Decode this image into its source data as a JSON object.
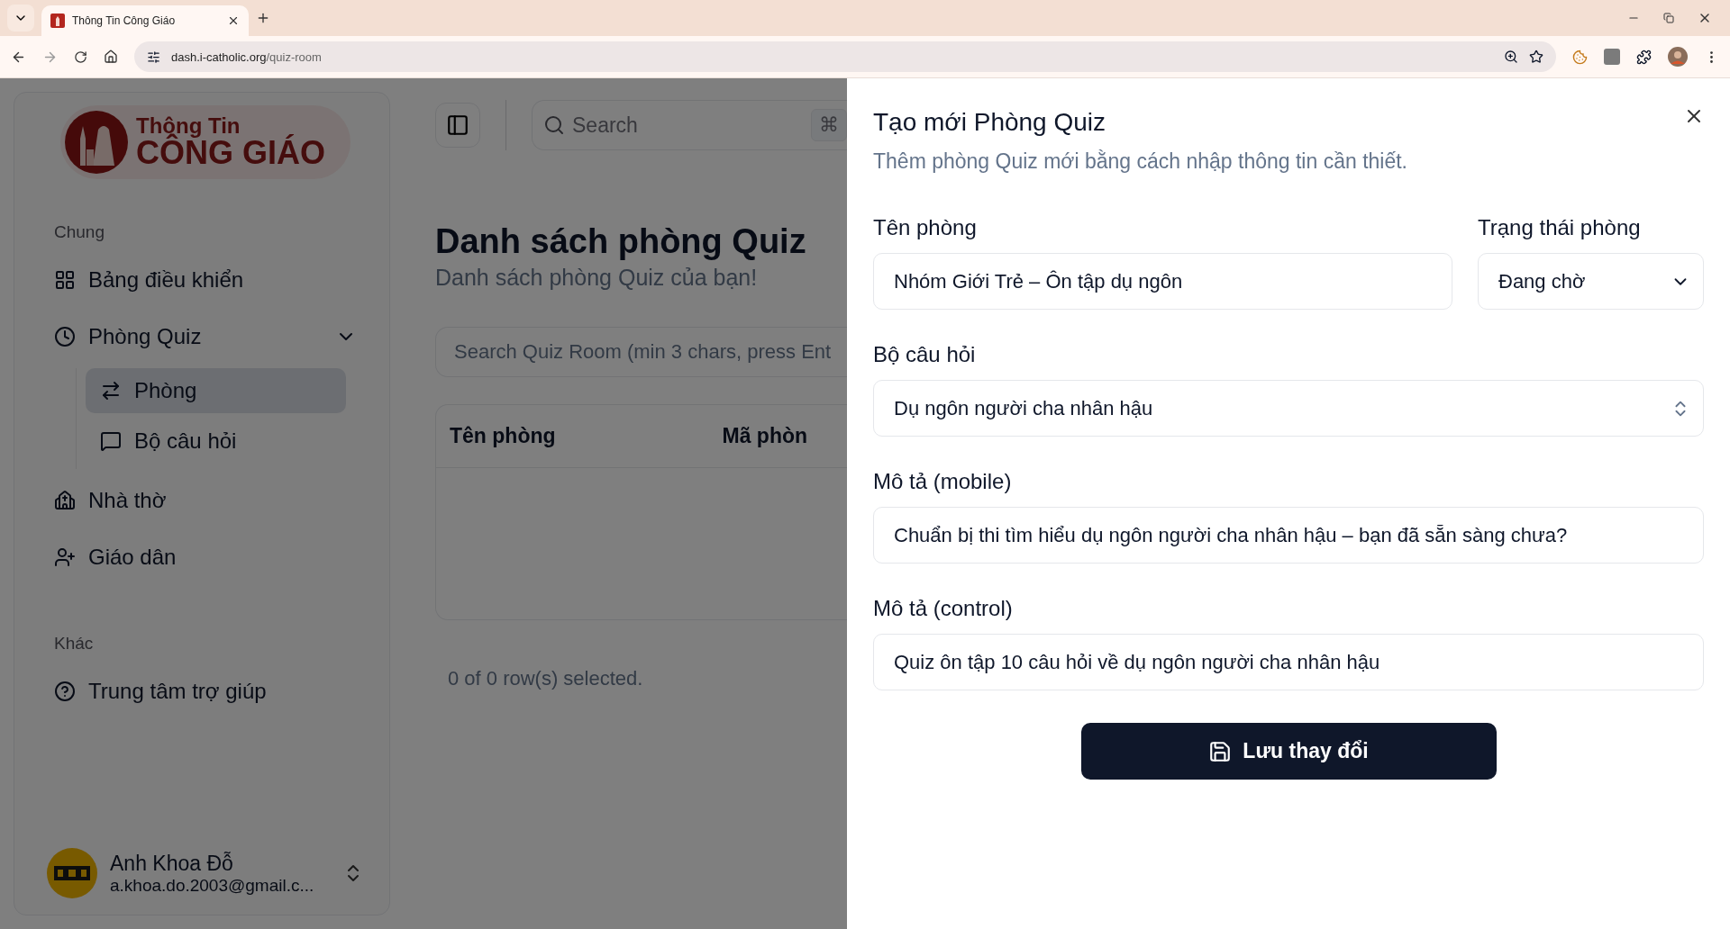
{
  "browser": {
    "tab": {
      "title": "Thông Tin Công Giáo"
    },
    "url": {
      "domain": "dash.i-catholic.org",
      "path": "/quiz-room"
    }
  },
  "sidebar": {
    "logo": {
      "line_1": "Thông Tin",
      "line_2": "CÔNG GIÁO"
    },
    "sections": [
      {
        "heading": "Chung",
        "items": [
          {
            "label": "Bảng điều khiển",
            "selected": false
          },
          {
            "label": "Phòng Quiz",
            "selected": false,
            "expanded": true,
            "children": [
              {
                "label": "Phòng",
                "selected": true
              },
              {
                "label": "Bộ câu hỏi",
                "selected": false
              }
            ]
          },
          {
            "label": "Nhà thờ",
            "selected": false
          },
          {
            "label": "Giáo dân",
            "selected": false
          }
        ]
      },
      {
        "heading": "Khác",
        "items": [
          {
            "label": "Trung tâm trợ giúp",
            "selected": false
          }
        ]
      }
    ],
    "user": {
      "name": "Anh Khoa Đỗ",
      "email": "a.khoa.do.2003@gmail.c..."
    }
  },
  "main": {
    "search": {
      "placeholder": "Search",
      "shortcut": "⌘"
    },
    "title": "Danh sách phòng Quiz",
    "subtitle": "Danh sách phòng Quiz của bạn!",
    "filter": {
      "placeholder": "Search Quiz Room (min 3 chars, press Ent"
    },
    "table": {
      "columns": [
        "Tên phòng",
        "Mã phòn"
      ]
    },
    "footer": "0 of 0 row(s) selected."
  },
  "sheet": {
    "title": "Tạo mới Phòng Quiz",
    "description": "Thêm phòng Quiz mới bằng cách nhập thông tin cần thiết.",
    "rows": [
      [
        {
          "kind": "text",
          "label": "Tên phòng",
          "value": "Nhóm Giới Trẻ – Ôn tập dụ ngôn"
        },
        {
          "kind": "select",
          "label": "Trạng thái phòng",
          "value": "Đang chờ"
        }
      ],
      [
        {
          "kind": "combobox",
          "label": "Bộ câu hỏi",
          "value": "Dụ ngôn người cha nhân hậu"
        }
      ],
      [
        {
          "kind": "text",
          "label": "Mô tả (mobile)",
          "value": "Chuẩn bị thi tìm hiểu dụ ngôn người cha nhân hậu – bạn đã sẵn sàng chưa?"
        }
      ],
      [
        {
          "kind": "text",
          "label": "Mô tả (control)",
          "value": "Quiz ôn tập 10 câu hỏi về dụ ngôn người cha nhân hậu"
        }
      ]
    ],
    "submit": "Lưu thay đổi"
  }
}
